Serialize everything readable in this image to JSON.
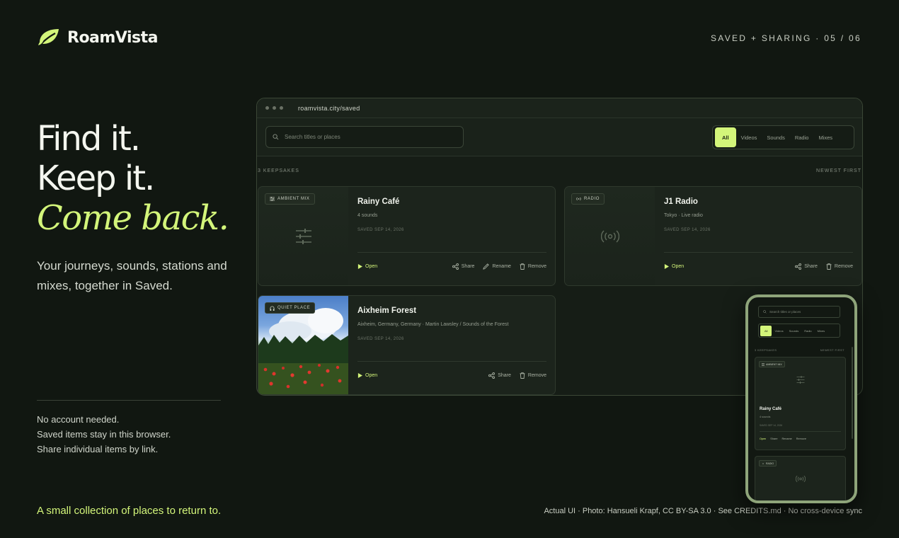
{
  "brand": {
    "name": "RoamVista",
    "icon": "leaf-icon"
  },
  "step": {
    "label": "SAVED + SHARING · 05 / 06"
  },
  "hero": {
    "line1": "Find it.",
    "line2": "Keep it.",
    "line3": "Come back.",
    "subtitle": "Your journeys, sounds, stations and mixes, together in Saved."
  },
  "notes": [
    "No account needed.",
    "Saved items stay in this browser.",
    "Share individual items by link."
  ],
  "tagline": "A small collection of places to return to.",
  "credits": "Actual UI · Photo: Hansueli Krapf, CC BY-SA 3.0 · See CREDITS.md · No cross-device sync",
  "colors": {
    "accent": "#d3f57a",
    "background": "#111711",
    "phone_frame": "#8ea47a"
  },
  "browser": {
    "url": "roamvista.city/saved",
    "search_placeholder": "Search titles or places",
    "filters": [
      "All",
      "Videos",
      "Sounds",
      "Radio",
      "Mixes"
    ],
    "active_filter": "All",
    "count_label": "3 KEEPSAKES",
    "sort_label": "NEWEST FIRST",
    "cards": [
      {
        "badge": "AMBIENT MIX",
        "title": "Rainy Café",
        "subtitle": "4 sounds",
        "saved": "SAVED SEP 14, 2026",
        "actions": {
          "open": "Open",
          "share": "Share",
          "rename": "Rename",
          "remove": "Remove"
        }
      },
      {
        "badge": "RADIO",
        "title": "J1 Radio",
        "subtitle": "Tokyo · Live radio",
        "saved": "SAVED SEP 14, 2026",
        "actions": {
          "open": "Open",
          "share": "Share",
          "remove": "Remove"
        }
      },
      {
        "badge": "QUIET PLACE",
        "title": "Aixheim Forest",
        "subtitle": "Aixheim, Germany, Germany · Martin Lawsley / Sounds of the Forest",
        "saved": "SAVED SEP 14, 2026",
        "actions": {
          "open": "Open",
          "share": "Share",
          "remove": "Remove"
        }
      }
    ]
  },
  "phone": {
    "search_placeholder": "Search titles or places",
    "filters": [
      "All",
      "Videos",
      "Sounds",
      "Radio",
      "Mixes"
    ],
    "count_label": "3 KEEPSAKES",
    "sort_label": "NEWEST FIRST",
    "card1": {
      "badge": "AMBIENT MIX",
      "title": "Rainy Café",
      "subtitle": "4 sounds",
      "saved": "SAVED SEP 14, 2026",
      "actions": {
        "open": "Open",
        "share": "Share",
        "rename": "Rename",
        "remove": "Remove"
      }
    },
    "card2": {
      "badge": "RADIO"
    }
  }
}
